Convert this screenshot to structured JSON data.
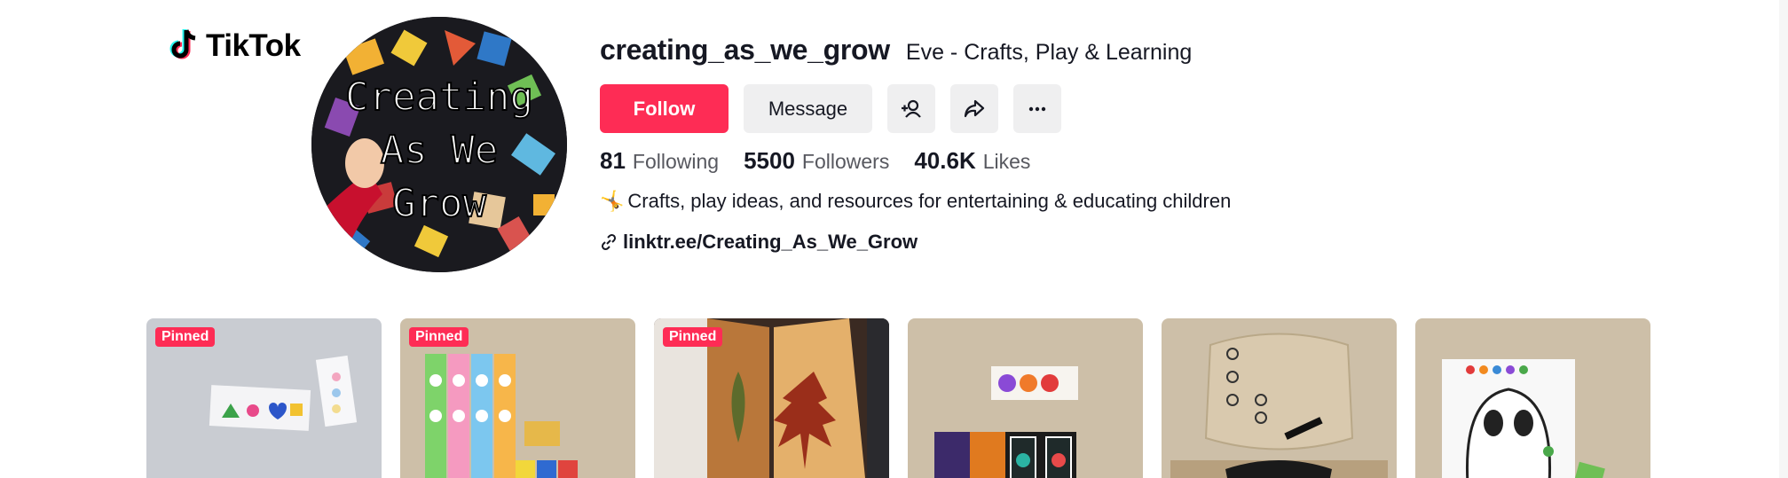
{
  "brand": {
    "name": "TikTok"
  },
  "profile": {
    "username": "creating_as_we_grow",
    "nickname": "Eve - Crafts, Play & Learning",
    "avatar_text": [
      "Creating",
      "As We",
      "Grow"
    ],
    "bio": "Crafts, play ideas, and resources for entertaining & educating children",
    "bio_emoji": "🤸",
    "link": "linktr.ee/Creating_As_We_Grow"
  },
  "actions": {
    "follow": "Follow",
    "message": "Message",
    "icons": [
      "add-friend-icon",
      "share-icon",
      "more-icon"
    ]
  },
  "stats": {
    "following": {
      "value": "81",
      "label": "Following"
    },
    "followers": {
      "value": "5500",
      "label": "Followers"
    },
    "likes": {
      "value": "40.6K",
      "label": "Likes"
    }
  },
  "videos": [
    {
      "badge": "Pinned",
      "theme": "shapes-card"
    },
    {
      "badge": "Pinned",
      "theme": "animal-tiles"
    },
    {
      "badge": "Pinned",
      "theme": "leaf-lantern"
    },
    {
      "badge": "",
      "theme": "halloween-cards"
    },
    {
      "badge": "",
      "theme": "letter-board"
    },
    {
      "badge": "",
      "theme": "ghost-worksheet"
    }
  ],
  "colors": {
    "accent": "#fe2c55",
    "button_grey": "#efeff0",
    "text": "#161823"
  }
}
